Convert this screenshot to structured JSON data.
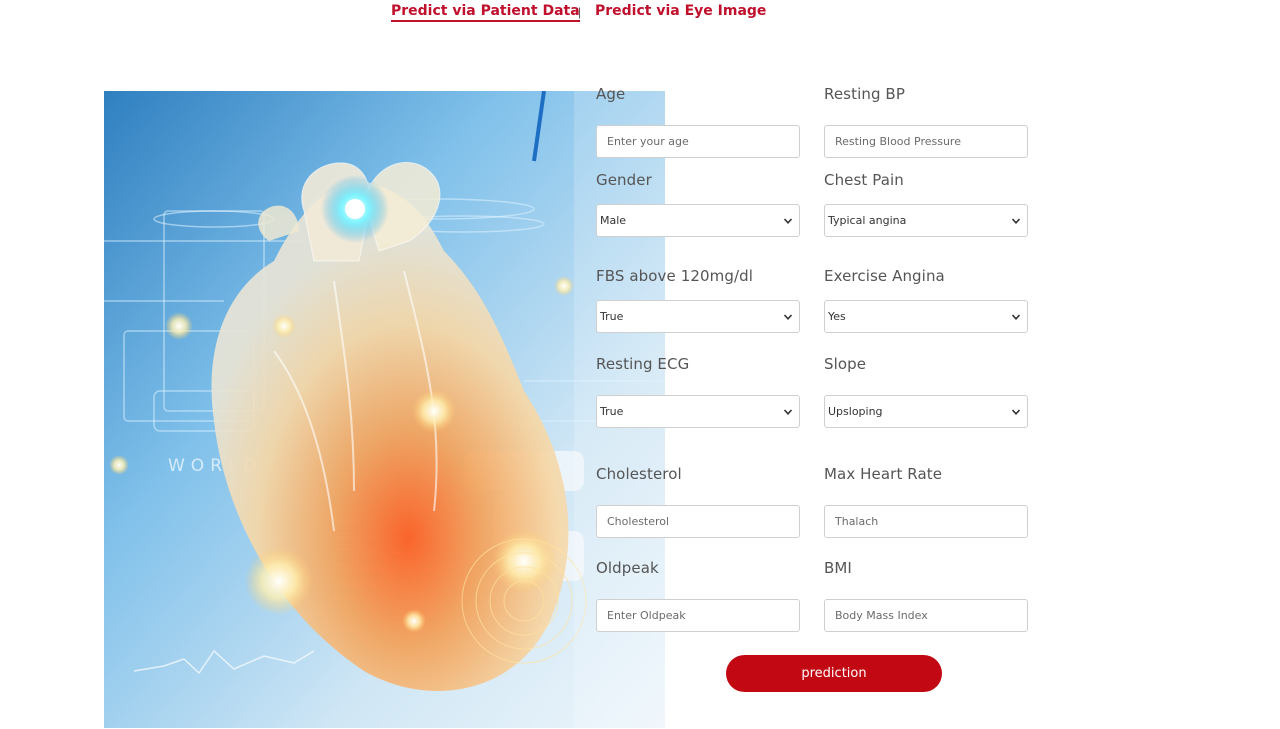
{
  "nav": {
    "patient_data": "Predict via Patient Data",
    "separator": "|",
    "eye_image": "Predict via Eye Image"
  },
  "hero": {
    "world_text": "WORLD"
  },
  "form": {
    "age": {
      "label": "Age",
      "placeholder": "Enter your age"
    },
    "resting_bp": {
      "label": "Resting BP",
      "placeholder": "Resting Blood Pressure"
    },
    "gender": {
      "label": "Gender",
      "value": "Male"
    },
    "chest_pain": {
      "label": "Chest Pain",
      "value": "Typical angina"
    },
    "fbs": {
      "label": "FBS above 120mg/dl",
      "value": "True"
    },
    "exercise_angina": {
      "label": "Exercise Angina",
      "value": "Yes"
    },
    "resting_ecg": {
      "label": "Resting ECG",
      "value": "True"
    },
    "slope": {
      "label": "Slope",
      "value": "Upsloping"
    },
    "cholesterol": {
      "label": "Cholesterol",
      "placeholder": "Cholesterol"
    },
    "max_heart_rate": {
      "label": "Max Heart Rate",
      "placeholder": "Thalach"
    },
    "oldpeak": {
      "label": "Oldpeak",
      "placeholder": "Enter Oldpeak"
    },
    "bmi": {
      "label": "BMI",
      "placeholder": "Body Mass Index"
    },
    "submit_label": "prediction"
  },
  "colors": {
    "accent": "#c0102c",
    "button": "#c20812"
  },
  "icons": {
    "select_caret": "chevron-down-icon"
  }
}
